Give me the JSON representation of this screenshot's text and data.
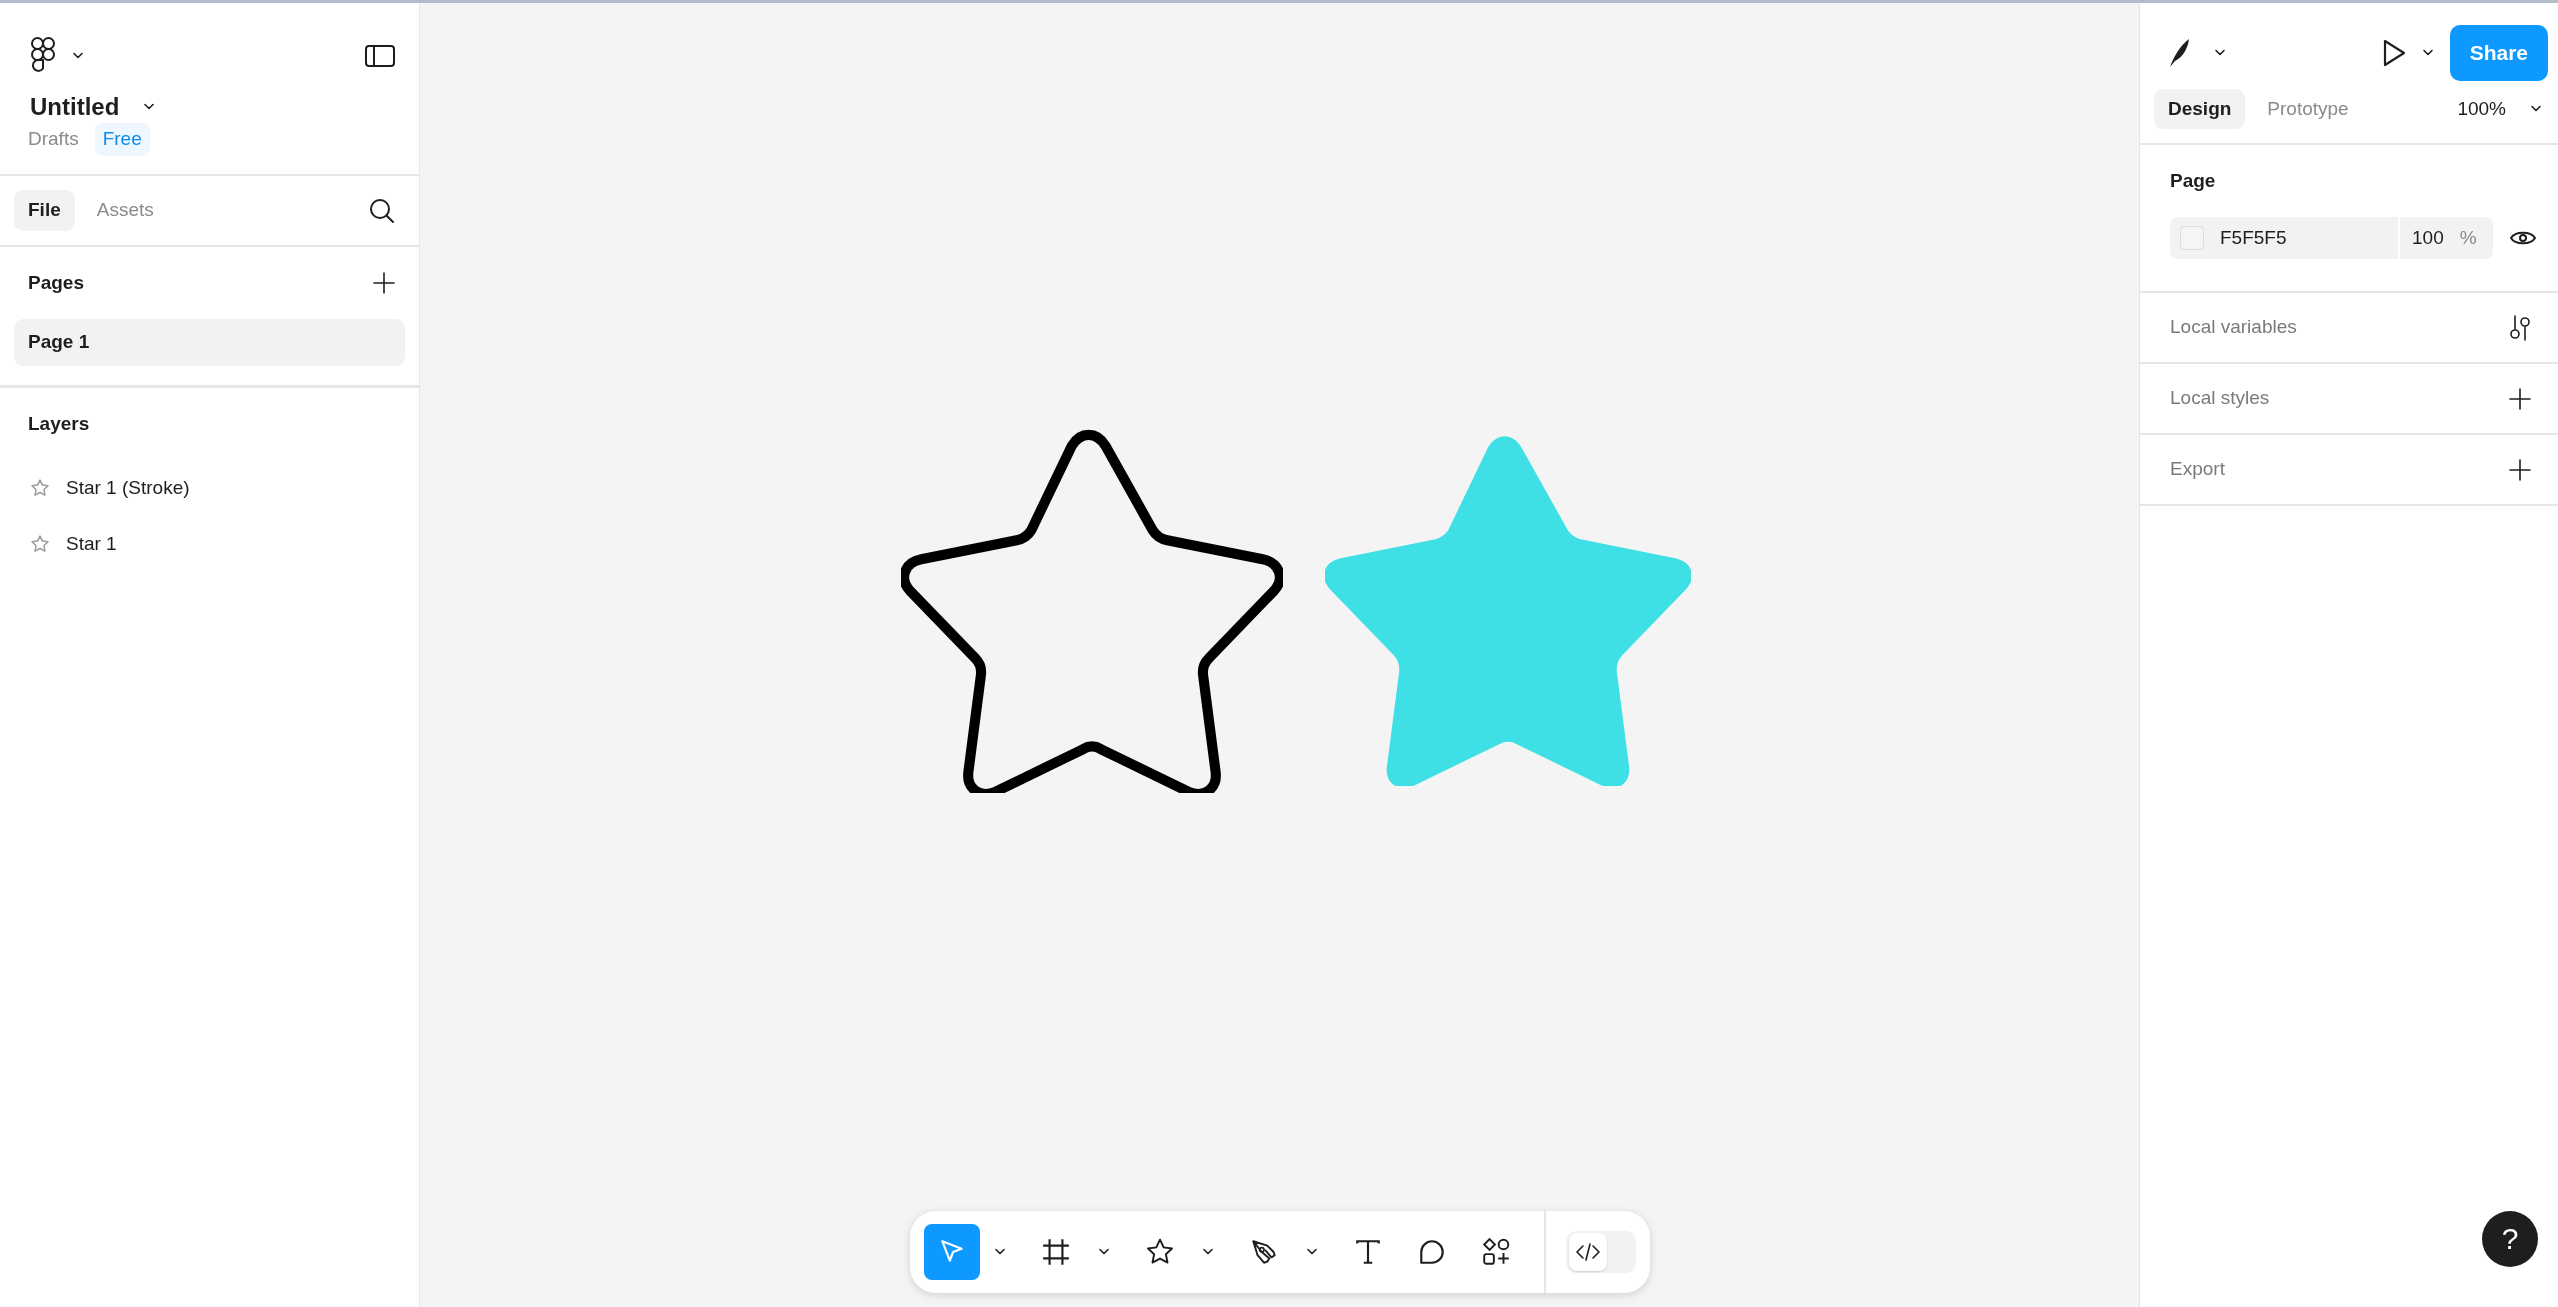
{
  "file": {
    "title": "Untitled",
    "location": "Drafts",
    "plan": "Free"
  },
  "left_tabs": [
    {
      "label": "File",
      "selected": true
    },
    {
      "label": "Assets",
      "selected": false
    }
  ],
  "pages": {
    "heading": "Pages",
    "items": [
      {
        "label": "Page 1",
        "selected": true
      }
    ]
  },
  "layers": {
    "heading": "Layers",
    "items": [
      {
        "label": "Star 1 (Stroke)"
      },
      {
        "label": "Star 1"
      }
    ]
  },
  "canvas": {
    "shapes": [
      {
        "kind": "outline",
        "color": "#000000"
      },
      {
        "kind": "filled",
        "color": "#3ee0e6"
      }
    ]
  },
  "toolbar": {
    "tools": [
      {
        "kind": "move",
        "selected": true,
        "dropdown": true
      },
      {
        "kind": "frame",
        "selected": false,
        "dropdown": true
      },
      {
        "kind": "shape",
        "selected": false,
        "dropdown": true
      },
      {
        "kind": "pen",
        "selected": false,
        "dropdown": true
      },
      {
        "kind": "text",
        "selected": false,
        "dropdown": false
      },
      {
        "kind": "comment",
        "selected": false,
        "dropdown": false
      },
      {
        "kind": "actions",
        "selected": false,
        "dropdown": false
      }
    ],
    "dev_mode": {
      "on": false
    }
  },
  "right_panel": {
    "share": "Share",
    "tabs": [
      {
        "label": "Design",
        "selected": true
      },
      {
        "label": "Prototype",
        "selected": false
      }
    ],
    "zoom": "100%",
    "page": {
      "heading": "Page",
      "fill": "F5F5F5",
      "opacity": "100",
      "unit": "%",
      "visible": true
    },
    "sections": [
      {
        "kind": "variables",
        "label": "Local variables"
      },
      {
        "kind": "add",
        "label": "Local styles"
      },
      {
        "kind": "add",
        "label": "Export"
      }
    ]
  },
  "help": "?"
}
